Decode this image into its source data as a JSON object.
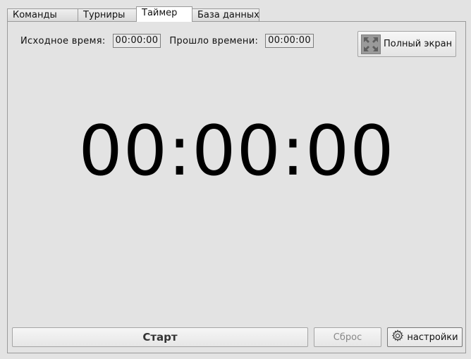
{
  "tabs": [
    {
      "label": "Команды",
      "active": false
    },
    {
      "label": "Турниры",
      "active": false
    },
    {
      "label": "Таймер",
      "active": true
    },
    {
      "label": "База данных",
      "active": false
    }
  ],
  "timer": {
    "initial_label": "Исходное время:",
    "initial_value": "00:00:00",
    "elapsed_label": "Прошло времени:",
    "elapsed_value": "00:00:00",
    "display": "00:00:00"
  },
  "fullscreen": {
    "label": "Полный экран",
    "icon": "fullscreen-icon"
  },
  "buttons": {
    "start": "Старт",
    "reset": "Сброс",
    "settings": "настройки",
    "settings_icon": "gear-icon"
  }
}
